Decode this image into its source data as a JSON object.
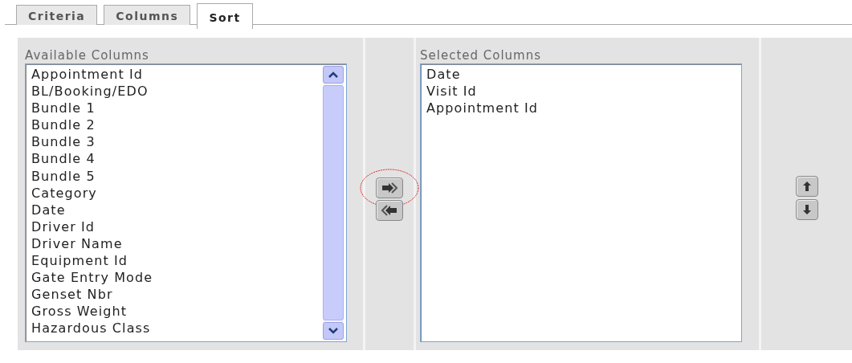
{
  "tabs": [
    {
      "label": "Criteria",
      "selected": false
    },
    {
      "label": "Columns",
      "selected": false
    },
    {
      "label": "Sort",
      "selected": true
    }
  ],
  "available": {
    "label": "Available Columns",
    "items": [
      "Appointment Id",
      "BL/Booking/EDO",
      "Bundle 1",
      "Bundle 2",
      "Bundle 3",
      "Bundle 4",
      "Bundle 5",
      "Category",
      "Date",
      "Driver Id",
      "Driver Name",
      "Equipment Id",
      "Gate Entry Mode",
      "Genset Nbr",
      "Gross Weight",
      "Hazardous Class"
    ]
  },
  "move_buttons": [
    {
      "kind": "add",
      "highlighted": true
    },
    {
      "kind": "remove",
      "highlighted": false
    }
  ],
  "selected": {
    "label": "Selected Columns",
    "items": [
      "Date",
      "Visit Id",
      "Appointment Id"
    ]
  },
  "order_buttons": [
    {
      "kind": "up"
    },
    {
      "kind": "down"
    }
  ]
}
